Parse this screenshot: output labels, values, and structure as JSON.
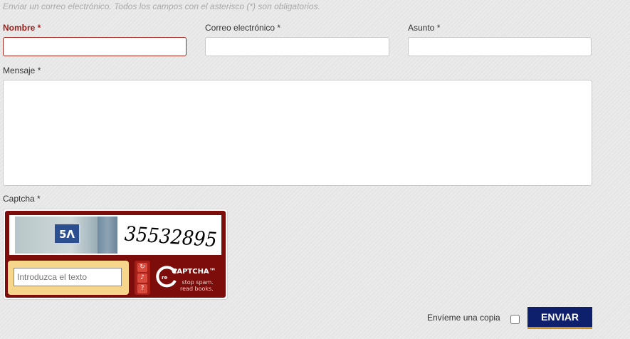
{
  "form": {
    "intro": "Enviar un correo electrónico. Todos los campos con el asterisco (*) son obligatorios.",
    "name_label": "Nombre *",
    "name_value": "",
    "email_label": "Correo electrónico *",
    "email_value": "",
    "subject_label": "Asunto *",
    "subject_value": "",
    "message_label": "Mensaje *",
    "message_value": "",
    "captcha_label": "Captcha *",
    "copy_label": "Envíeme una copia",
    "copy_checked": false,
    "submit_label": "ENVIAR"
  },
  "captcha": {
    "plate_text": "5Λ",
    "word_text": "35532895",
    "response_placeholder": "Introduzca el texto",
    "buttons": [
      {
        "name": "refresh-icon",
        "symbol": "↻"
      },
      {
        "name": "audio-icon",
        "symbol": "♪"
      },
      {
        "name": "help-icon",
        "symbol": "?"
      }
    ],
    "logo_re": "re",
    "logo_text": "CAPTCHA™",
    "logo_tagline": "stop spam.\nread books."
  },
  "colors": {
    "error": "#9e1b16",
    "captcha_frame": "#7d0d0a",
    "submit_bg": "#0e1f6c",
    "submit_underline": "#c8941e"
  }
}
